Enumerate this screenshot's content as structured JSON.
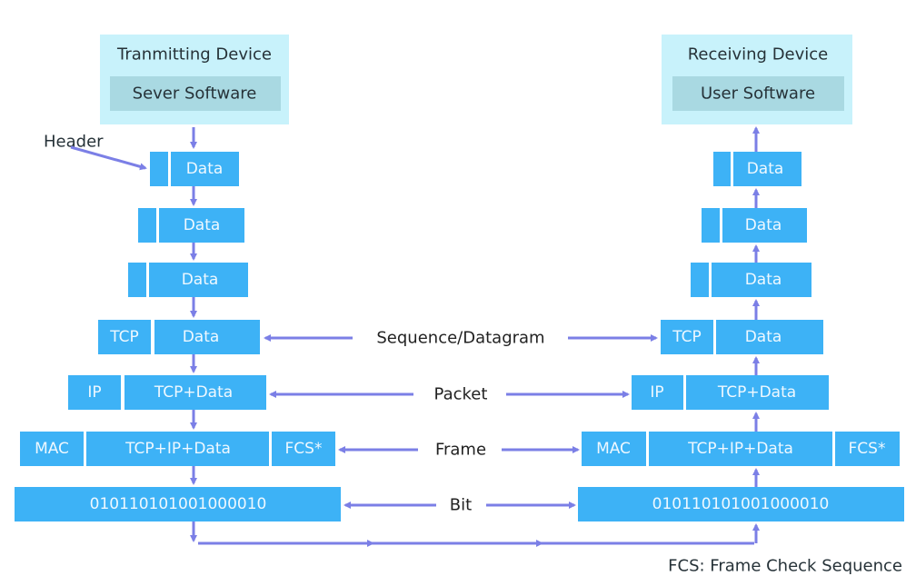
{
  "sender": {
    "title": "Tranmitting Device",
    "software": "Sever Software"
  },
  "receiver": {
    "title": "Receiving Device",
    "software": "User Software"
  },
  "header_label": "Header",
  "blocks": {
    "data": "Data",
    "tcp": "TCP",
    "ip": "IP",
    "tcp_data": "TCP+Data",
    "mac": "MAC",
    "tcp_ip_data": "TCP+IP+Data",
    "fcs": "FCS*",
    "bits": "010110101001000010"
  },
  "layers": {
    "segment": "Sequence/Datagram",
    "packet": "Packet",
    "frame": "Frame",
    "bit": "Bit"
  },
  "footnote": "FCS: Frame Check Sequence",
  "colors": {
    "block": "#3db2f6",
    "device": "#c8f2fb",
    "software": "#a9d9e2",
    "arrow": "#7b7fe6"
  }
}
